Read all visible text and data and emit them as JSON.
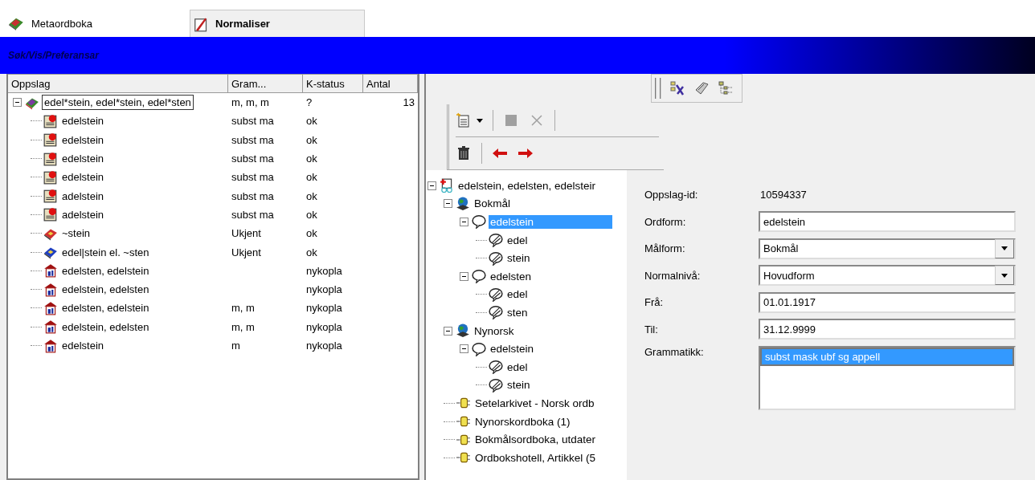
{
  "tabs": [
    {
      "label": "Metaordboka",
      "selected": false,
      "kind": "book"
    },
    {
      "label": "Normaliser",
      "selected": true,
      "kind": "pen"
    }
  ],
  "title_bar": {
    "title": "Søk/Vis/Preferansar"
  },
  "lookup_table": {
    "columns": [
      "Oppslag",
      "Gram...",
      "K-status",
      "Antal"
    ],
    "rows": [
      {
        "kind": "stack",
        "entry": "edel*stein, edel*stein, edel*sten",
        "gram": "m, m, m",
        "status": "?",
        "count": "13",
        "expanded": true,
        "focused": true,
        "children": [
          {
            "kind": "doc",
            "entry": "edelstein",
            "gram": "subst ma",
            "status": "ok"
          },
          {
            "kind": "doc",
            "entry": "edelstein",
            "gram": "subst ma",
            "status": "ok"
          },
          {
            "kind": "doc",
            "entry": "edelstein",
            "gram": "subst ma",
            "status": "ok"
          },
          {
            "kind": "doc",
            "entry": "edelstein",
            "gram": "subst ma",
            "status": "ok"
          },
          {
            "kind": "doc",
            "entry": "adelstein",
            "gram": "subst ma",
            "status": "ok"
          },
          {
            "kind": "doc",
            "entry": "adelstein",
            "gram": "subst ma",
            "status": "ok"
          },
          {
            "kind": "redbook",
            "entry": "~stein",
            "gram": "Ukjent",
            "status": "ok"
          },
          {
            "kind": "bluebook",
            "entry": "edel|stein el. ~sten",
            "gram": "Ukjent",
            "status": "ok"
          },
          {
            "kind": "house",
            "entry": "edelsten, edelstein",
            "status": "nykopla"
          },
          {
            "kind": "house",
            "entry": "edelstein, edelsten",
            "status": "nykopla"
          },
          {
            "kind": "house",
            "entry": "edelsten, edelstein",
            "gram": "m, m",
            "status": "nykopla"
          },
          {
            "kind": "house",
            "entry": "edelstein, edelsten",
            "gram": "m, m",
            "status": "nykopla"
          },
          {
            "kind": "house",
            "entry": "edelstein",
            "gram": "m",
            "status": "nykopla"
          }
        ]
      }
    ]
  },
  "top_toolbar": [
    {
      "kind": "checklist"
    },
    {
      "kind": "tag"
    },
    {
      "kind": "tree"
    }
  ],
  "edit_toolbar": [
    {
      "kind": "new"
    },
    {
      "kind": "save",
      "disabled": true
    },
    {
      "kind": "delete",
      "disabled": true
    }
  ],
  "nav_toolbar": [
    {
      "kind": "trash"
    },
    {
      "kind": "back"
    },
    {
      "kind": "forward"
    }
  ],
  "form_tree": [
    {
      "kind": "article",
      "label": "edelstein, edelsten, edelsteir",
      "expanded": true,
      "selected": false,
      "children": [
        {
          "kind": "globe",
          "label": "Bokmål",
          "expanded": true,
          "selected": false,
          "children": [
            {
              "kind": "bubble",
              "label": "edelstein",
              "expanded": true,
              "selected": true,
              "children": [
                {
                  "kind": "part",
                  "label": "edel",
                  "selected": false
                },
                {
                  "kind": "part",
                  "label": "stein",
                  "selected": false
                }
              ]
            },
            {
              "kind": "bubble",
              "label": "edelsten",
              "expanded": true,
              "selected": false,
              "children": [
                {
                  "kind": "part",
                  "label": "edel",
                  "selected": false
                },
                {
                  "kind": "part",
                  "label": "sten",
                  "selected": false
                }
              ]
            }
          ]
        },
        {
          "kind": "globe",
          "label": "Nynorsk",
          "expanded": true,
          "selected": false,
          "children": [
            {
              "kind": "bubble",
              "label": "edelstein",
              "expanded": true,
              "selected": false,
              "children": [
                {
                  "kind": "part",
                  "label": "edel",
                  "selected": false
                },
                {
                  "kind": "part",
                  "label": "stein",
                  "selected": false
                }
              ]
            }
          ]
        },
        {
          "kind": "source",
          "label": "Setelarkivet - Norsk ordb",
          "selected": false
        },
        {
          "kind": "source",
          "label": "Nynorskordboka (1)",
          "selected": false
        },
        {
          "kind": "source",
          "label": "Bokmålsordboka, utdater",
          "selected": false
        },
        {
          "kind": "source",
          "label": "Ordbokshotell, Artikkel (5",
          "selected": false
        }
      ]
    }
  ],
  "form": [
    {
      "kind": "static",
      "label": "Oppslag-id:",
      "value": "10594337"
    },
    {
      "kind": "text",
      "label": "Ordform:",
      "value": "edelstein"
    },
    {
      "kind": "select",
      "label": "Målform:",
      "value": "Bokmål"
    },
    {
      "kind": "select",
      "label": "Normalnivå:",
      "value": "Hovudform"
    },
    {
      "kind": "text",
      "label": "Frå:",
      "value": "01.01.1917"
    },
    {
      "kind": "text",
      "label": "Til:",
      "value": "31.12.9999"
    },
    {
      "kind": "list",
      "label": "Grammatikk:",
      "items": [
        {
          "text": "subst mask ubf sg appell",
          "selected": true
        }
      ]
    }
  ]
}
